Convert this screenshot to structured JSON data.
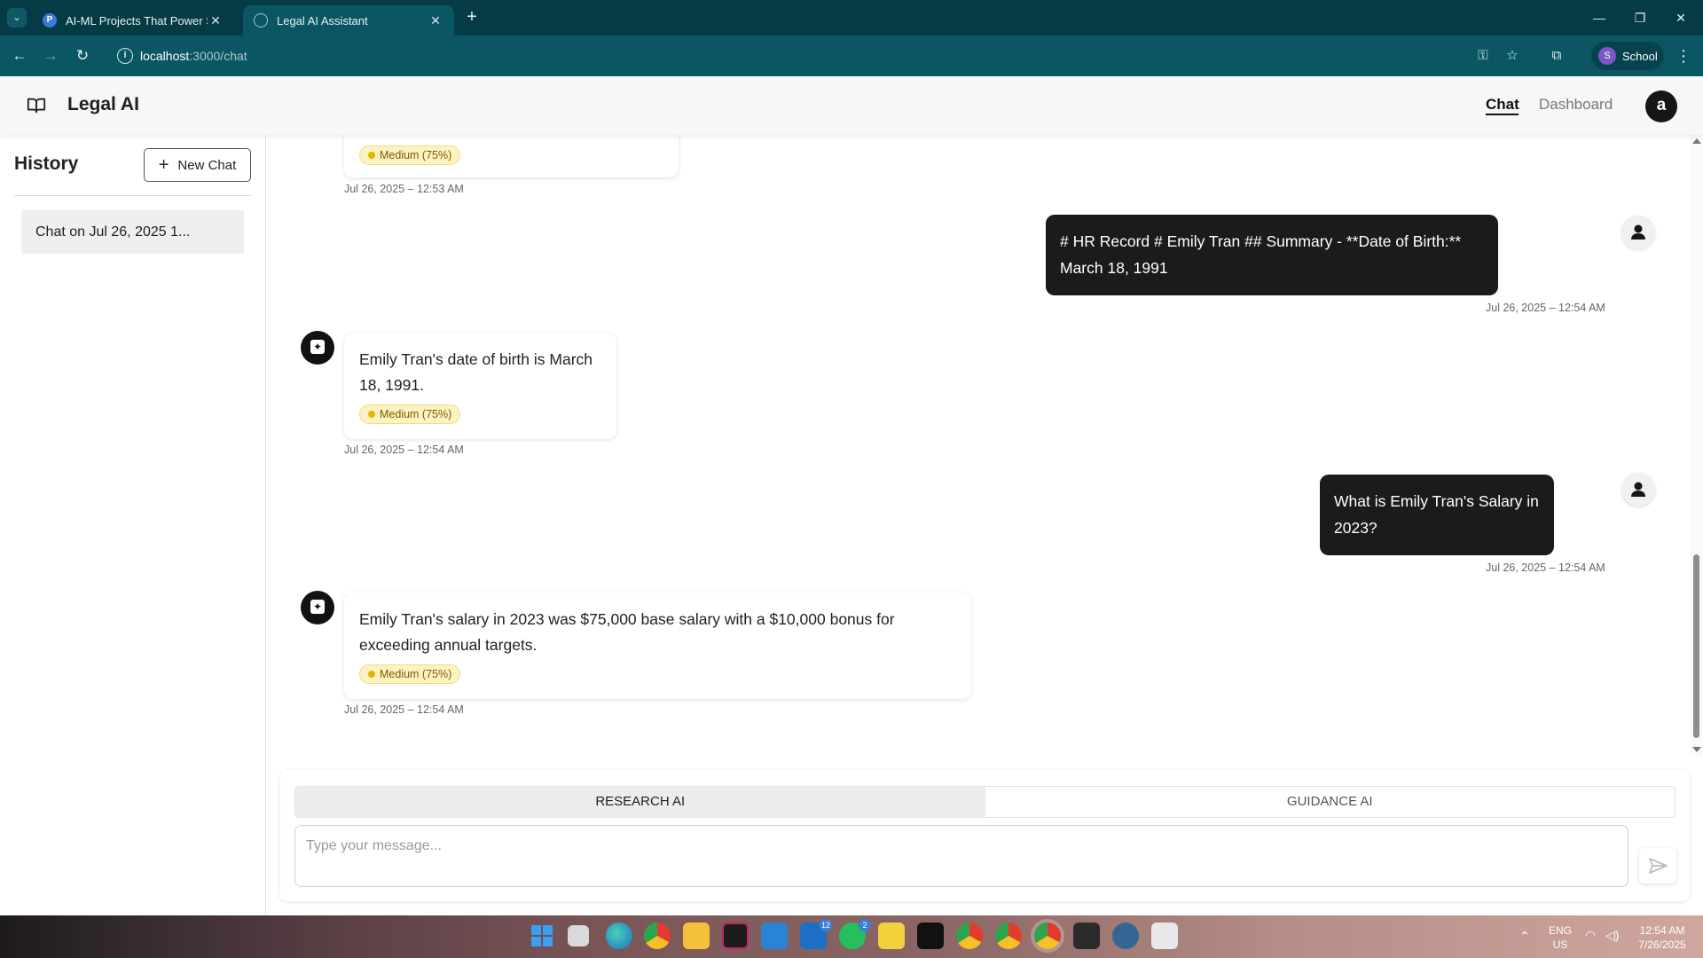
{
  "browser": {
    "tabs": [
      {
        "title": "AI-ML Projects That Power SaaS",
        "favicon": "perplexity-icon",
        "active": false
      },
      {
        "title": "Legal AI Assistant",
        "favicon": "globe-icon",
        "active": true
      }
    ],
    "url_host": "localhost",
    "url_path": ":3000/chat",
    "profile_initial": "S",
    "profile_name": "School",
    "theme_color": "#0b5663"
  },
  "app": {
    "brand": "Legal AI",
    "nav": {
      "chat": "Chat",
      "dashboard": "Dashboard",
      "active": "Chat"
    },
    "user_initial": "a"
  },
  "sidebar": {
    "title": "History",
    "new_chat_label": "New Chat",
    "items": [
      {
        "label": "Chat on Jul 26, 2025 1..."
      }
    ]
  },
  "messages": [
    {
      "role": "bot",
      "text": "",
      "badge": "Medium (75%)",
      "timestamp": "Jul 26, 2025 – 12:53 AM"
    },
    {
      "role": "user",
      "text": "# HR Record # Emily Tran ## Summary - **Date of Birth:** March 18, 1991",
      "timestamp": "Jul 26, 2025 – 12:54 AM"
    },
    {
      "role": "bot",
      "text": "Emily Tran's date of birth is March 18, 1991.",
      "badge": "Medium (75%)",
      "timestamp": "Jul 26, 2025 – 12:54 AM"
    },
    {
      "role": "user",
      "text": "What is Emily Tran's Salary in 2023?",
      "timestamp": "Jul 26, 2025 – 12:54 AM"
    },
    {
      "role": "bot",
      "text": "Emily Tran's salary in 2023 was $75,000 base salary with a $10,000 bonus for exceeding annual targets.",
      "badge": "Medium (75%)",
      "timestamp": "Jul 26, 2025 – 12:54 AM"
    }
  ],
  "composer": {
    "modes": [
      "RESEARCH AI",
      "GUIDANCE AI"
    ],
    "active_mode": "RESEARCH AI",
    "placeholder": "Type your message...",
    "value": ""
  },
  "taskbar": {
    "apps": [
      "windows-start-icon",
      "file-manager-icon",
      "edge-icon",
      "chrome-icon",
      "folder-icon",
      "app-icon",
      "vscode-icon",
      "outlook-icon",
      "whatsapp-icon",
      "sticky-notes-icon",
      "notion-icon",
      "chrome-profile-icon",
      "chrome-profile-icon",
      "chrome-profile-icon",
      "terminal-icon",
      "postgres-icon",
      "snipping-tool-icon"
    ],
    "badges": {
      "outlook": "12",
      "whatsapp": "2"
    },
    "lang_line1": "ENG",
    "lang_line2": "US",
    "time": "12:54 AM",
    "date": "7/26/2025"
  }
}
